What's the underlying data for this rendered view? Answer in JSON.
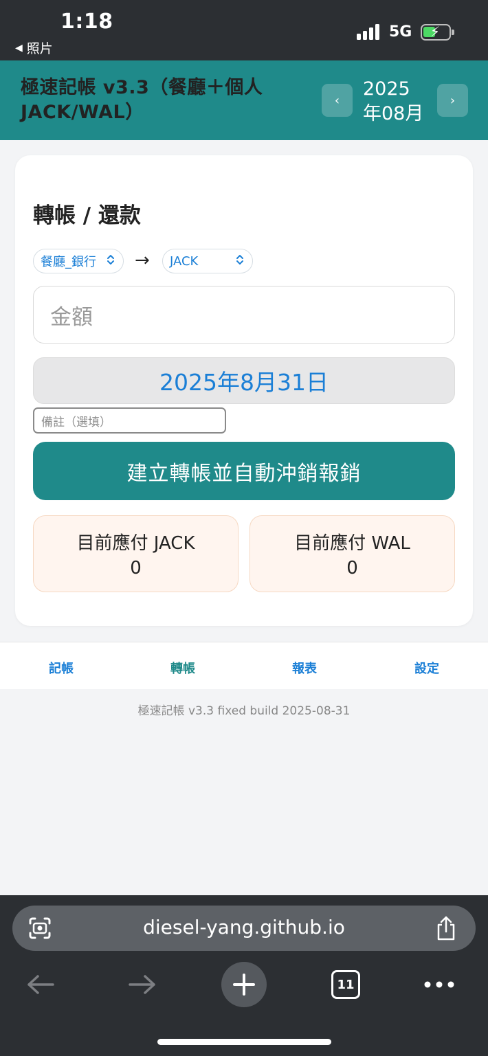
{
  "status_bar": {
    "time": "1:18",
    "back_app": "照片",
    "network": "5G"
  },
  "header": {
    "title": "極速記帳 v3.3（餐廳＋個人 JACK/WAL）",
    "prev_label": "‹",
    "next_label": "›",
    "month": "2025\n年08月"
  },
  "transfer": {
    "title": "轉帳 / 還款",
    "from_account": "餐廳_銀行",
    "arrow": "→",
    "to_account": "JACK",
    "amount_placeholder": "金額",
    "date": "2025年8月31日",
    "note_placeholder": "備註（選填）",
    "submit_label": "建立轉帳並自動沖銷報銷",
    "payables": [
      {
        "label": "目前應付 JACK",
        "value": "0"
      },
      {
        "label": "目前應付 WAL",
        "value": "0"
      }
    ]
  },
  "tabs": [
    "記帳",
    "轉帳",
    "報表",
    "設定"
  ],
  "active_tab": "轉帳",
  "footer": "極速記帳 v3.3 fixed build 2025-08-31",
  "browser": {
    "url": "diesel-yang.github.io",
    "tab_count": "11"
  },
  "colors": {
    "brand": "#1f8a8a",
    "link": "#1b7fd6",
    "payable_bg": "#fff5ef"
  }
}
